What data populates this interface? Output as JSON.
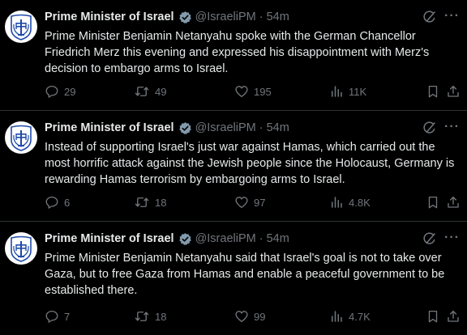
{
  "tweets": [
    {
      "author": "Prime Minister of Israel",
      "handle": "@IsraeliPM",
      "separator": "·",
      "time": "54m",
      "text": "Prime Minister Benjamin Netanyahu spoke with the German Chancellor Friedrich Merz this evening and expressed his disappointment with Merz's decision to embargo arms to Israel.",
      "replies": "29",
      "reposts": "49",
      "likes": "195",
      "views": "11K"
    },
    {
      "author": "Prime Minister of Israel",
      "handle": "@IsraeliPM",
      "separator": "·",
      "time": "54m",
      "text": "Instead of supporting Israel's just war against Hamas, which carried out the most horrific attack against the Jewish people since the Holocaust, Germany is rewarding Hamas terrorism by embargoing arms to Israel.",
      "replies": "6",
      "reposts": "18",
      "likes": "97",
      "views": "4.8K"
    },
    {
      "author": "Prime Minister of Israel",
      "handle": "@IsraeliPM",
      "separator": "·",
      "time": "54m",
      "text": "Prime Minister Benjamin Netanyahu said that Israel's goal is not to take over Gaza, but to free Gaza from Hamas and enable a peaceful government to be established there.",
      "replies": "7",
      "reposts": "18",
      "likes": "99",
      "views": "4.7K"
    }
  ],
  "more_glyph": "···",
  "colors": {
    "background": "#000000",
    "text": "#e7e9ea",
    "muted": "#71767b",
    "divider": "#2f3336",
    "verified_badge": "#829aab",
    "emblem": "#1f4aa8"
  },
  "icons": [
    "emblem-avatar-icon",
    "verified-badge-icon",
    "grok-icon",
    "more-icon",
    "reply-icon",
    "repost-icon",
    "like-icon",
    "views-icon",
    "bookmark-icon",
    "share-icon"
  ]
}
